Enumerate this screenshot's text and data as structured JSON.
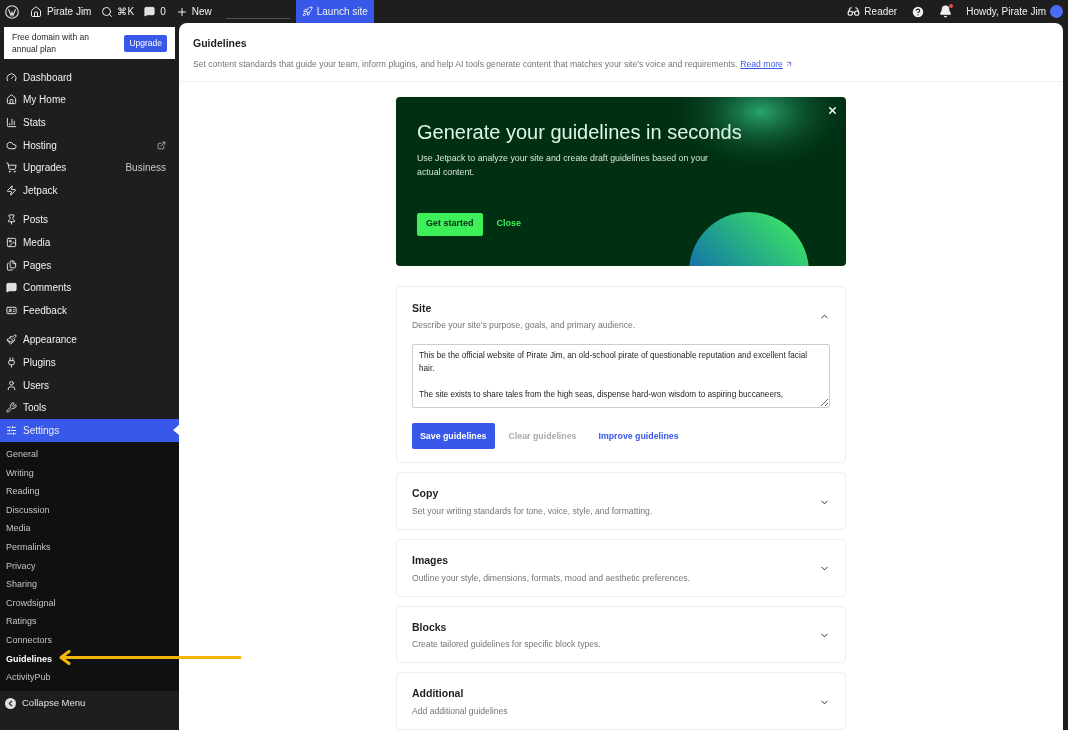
{
  "top_bar": {
    "site": "Pirate Jim",
    "search_shortcut": "⌘K",
    "comments_count": "0",
    "new_label": "New",
    "launch_label": "Launch site",
    "reader_label": "Reader",
    "notification_unread": true,
    "greeting": "Howdy, Pirate Jim"
  },
  "sidebar": {
    "promo": {
      "text": "Free domain with an annual plan",
      "button": "Upgrade"
    },
    "groups": [
      [
        {
          "label": "Dashboard",
          "selected": false
        },
        {
          "label": "My Home",
          "selected": false
        },
        {
          "label": "Stats",
          "selected": false
        },
        {
          "label": "Hosting",
          "external": true,
          "selected": false
        },
        {
          "label": "Upgrades",
          "badge": "Business",
          "selected": false
        },
        {
          "label": "Jetpack",
          "selected": false
        }
      ],
      [
        {
          "label": "Posts",
          "selected": false
        },
        {
          "label": "Media",
          "selected": false
        },
        {
          "label": "Pages",
          "selected": false
        },
        {
          "label": "Comments",
          "selected": false
        },
        {
          "label": "Feedback",
          "selected": false
        }
      ],
      [
        {
          "label": "Appearance",
          "selected": false
        },
        {
          "label": "Plugins",
          "selected": false
        },
        {
          "label": "Users",
          "selected": false
        },
        {
          "label": "Tools",
          "selected": false
        },
        {
          "label": "Settings",
          "selected": true
        }
      ]
    ],
    "submenu": [
      {
        "label": "General",
        "selected": false
      },
      {
        "label": "Writing",
        "selected": false
      },
      {
        "label": "Reading",
        "selected": false
      },
      {
        "label": "Discussion",
        "selected": false
      },
      {
        "label": "Media",
        "selected": false
      },
      {
        "label": "Permalinks",
        "selected": false
      },
      {
        "label": "Privacy",
        "selected": false
      },
      {
        "label": "Sharing",
        "selected": false
      },
      {
        "label": "Crowdsignal",
        "selected": false
      },
      {
        "label": "Ratings",
        "selected": false
      },
      {
        "label": "Connectors",
        "selected": false
      },
      {
        "label": "Guidelines",
        "selected": true
      },
      {
        "label": "ActivityPub",
        "selected": false
      }
    ],
    "collapse_label": "Collapse Menu"
  },
  "page": {
    "title": "Guidelines",
    "description": "Set content standards that guide your team, inform plugins, and help AI tools generate content that matches your site's voice and requirements.",
    "link": "Read more"
  },
  "banner": {
    "title": "Generate your guidelines in seconds",
    "text": "Use Jetpack to analyze your site and create draft guidelines based on your actual content.",
    "primary": "Get started",
    "secondary": "Close"
  },
  "sections": [
    {
      "title": "Site",
      "description": "Describe your site's purpose, goals, and primary audience.",
      "expanded": true,
      "value": "This be the official website of Pirate Jim, an old-school pirate of questionable reputation and excellent facial hair.\n\nThe site exists to share tales from the high seas, dispense hard-won wisdom to aspiring buccaneers,",
      "buttons": [
        {
          "label": "Save guidelines",
          "kind": "primary"
        },
        {
          "label": "Clear guidelines",
          "kind": "disabled"
        },
        {
          "label": "Improve guidelines",
          "kind": "link"
        }
      ]
    },
    {
      "title": "Copy",
      "description": "Set your writing standards for tone, voice, style, and formatting.",
      "expanded": false
    },
    {
      "title": "Images",
      "description": "Outline your style, dimensions, formats, mood and aesthetic preferences.",
      "expanded": false
    },
    {
      "title": "Blocks",
      "description": "Create tailored guidelines for specific block types.",
      "expanded": false
    },
    {
      "title": "Additional",
      "description": "Add additional guidelines",
      "expanded": false
    }
  ]
}
